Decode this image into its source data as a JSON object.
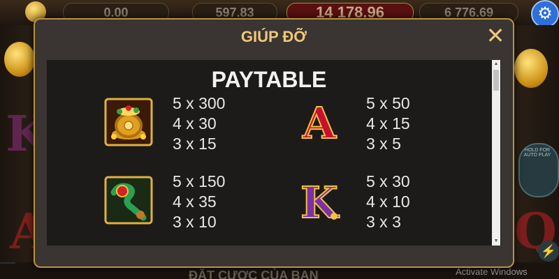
{
  "background": {
    "counters": [
      "0.00",
      "597.83",
      "14 178.96",
      "6 776.69"
    ],
    "bottom_text": "ĐẶT CƯỢC CỦA BẠN",
    "autoplay_label": "HOLD FOR AUTO PLAY"
  },
  "os": {
    "watermark": "Activate Windows"
  },
  "modal": {
    "title": "GIÚP ĐỠ",
    "close_label": "✕",
    "section_title": "PAYTABLE",
    "rows": [
      {
        "symbol": "gold-pot",
        "payouts": [
          "5 x 300",
          "4 x 30",
          "3 x 15"
        ]
      },
      {
        "symbol": "letter-a",
        "letter": "A",
        "payouts": [
          "5 x 50",
          "4 x 15",
          "3 x 5"
        ]
      },
      {
        "symbol": "jade-ruyi",
        "payouts": [
          "5 x 150",
          "4 x 35",
          "3 x 10"
        ]
      },
      {
        "symbol": "letter-k",
        "letter": "K",
        "payouts": [
          "5 x 30",
          "4 x 10",
          "3 x 3"
        ]
      }
    ]
  },
  "colors": {
    "accent_gold": "#f0c77a",
    "modal_border": "#b8923f",
    "panel_bg": "#1c1b1a",
    "letter_a": "#c8102e",
    "letter_k": "#7b2fa8"
  }
}
